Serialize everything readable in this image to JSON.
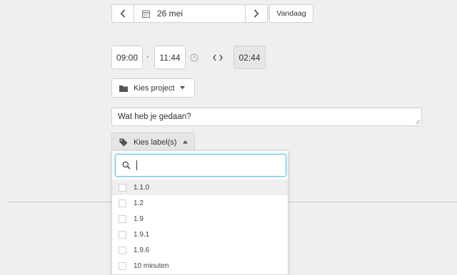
{
  "date_nav": {
    "prev_icon": "chevron-left-icon",
    "calendar_icon": "calendar-icon",
    "date": "26 mei",
    "next_icon": "chevron-right-icon",
    "today_label": "Vandaag"
  },
  "time": {
    "start": "09:00",
    "separator": "-",
    "end": "11:44",
    "clock_icon": "clock-icon",
    "swap_icon": "code-brackets-icon",
    "duration": "02:44"
  },
  "project": {
    "icon": "folder-icon",
    "label": "Kies project",
    "dropdown_icon": "caret-down-icon"
  },
  "description": {
    "placeholder": "Wat heb je gedaan?"
  },
  "labels": {
    "icon": "tag-icon",
    "label": "Kies label(s)",
    "dropdown_icon": "caret-up-icon",
    "search_icon": "search-icon",
    "search_value": "",
    "options": [
      "1.1.0",
      "1.2",
      "1.9",
      "1.9.1",
      "1.9.6",
      "10 minuten"
    ]
  }
}
